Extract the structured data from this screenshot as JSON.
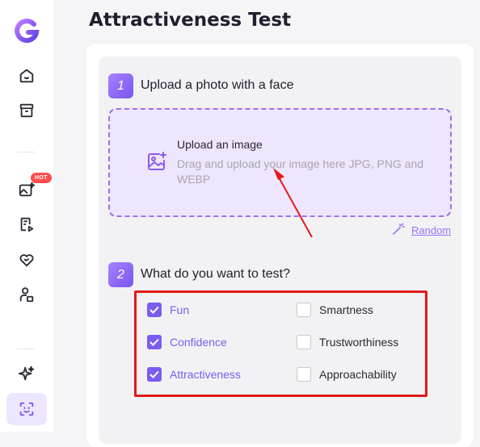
{
  "page": {
    "title": "Attractiveness Test"
  },
  "sidebar": {
    "items": [
      {
        "name": "home-icon",
        "active": false
      },
      {
        "name": "archive-icon",
        "active": false
      },
      {
        "name": "image-magic-icon",
        "active": false,
        "badge": "HOT"
      },
      {
        "name": "video-script-icon",
        "active": false
      },
      {
        "name": "heart-icon",
        "active": false
      },
      {
        "name": "person-icon",
        "active": false
      },
      {
        "name": "sparkles-icon",
        "active": false
      },
      {
        "name": "face-scan-icon",
        "active": true
      }
    ]
  },
  "step1": {
    "number": "1",
    "title": "Upload a photo with a face",
    "upload_heading": "Upload an image",
    "upload_description": "Drag and upload your image here JPG, PNG and WEBP",
    "random_label": "Random"
  },
  "step2": {
    "number": "2",
    "title": "What do you want to test?",
    "options": [
      {
        "label": "Fun",
        "checked": true
      },
      {
        "label": "Smartness",
        "checked": false
      },
      {
        "label": "Confidence",
        "checked": true
      },
      {
        "label": "Trustworthiness",
        "checked": false
      },
      {
        "label": "Attractiveness",
        "checked": true
      },
      {
        "label": "Approachability",
        "checked": false
      }
    ]
  },
  "colors": {
    "accent": "#7b5cf0",
    "upload_bg": "#ede6fc",
    "highlight_box": "#e21a1a",
    "hot_badge": "#ff4d4f"
  }
}
